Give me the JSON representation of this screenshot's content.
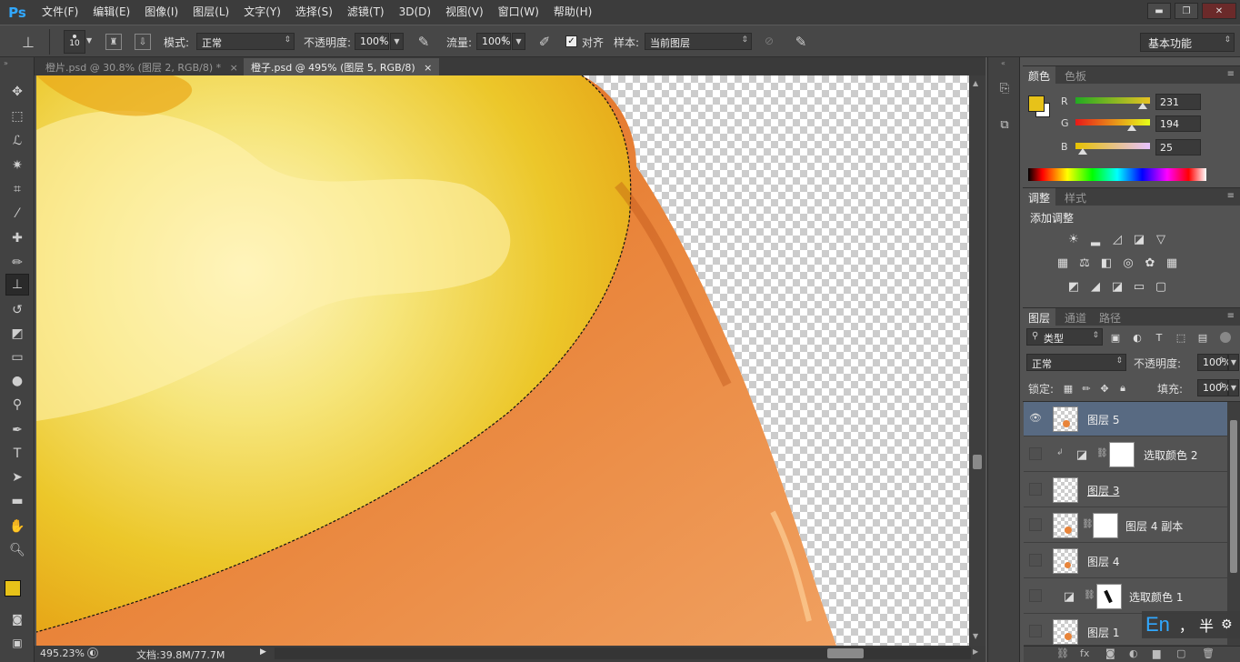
{
  "app": {
    "logo": "Ps"
  },
  "menu": [
    "文件(F)",
    "编辑(E)",
    "图像(I)",
    "图层(L)",
    "文字(Y)",
    "选择(S)",
    "滤镜(T)",
    "3D(D)",
    "视图(V)",
    "窗口(W)",
    "帮助(H)"
  ],
  "window_controls": {
    "minimize": "▬",
    "restore": "❐",
    "close": "✕"
  },
  "options": {
    "brush_size": "10",
    "mode_label": "模式:",
    "mode_value": "正常",
    "opacity_label": "不透明度:",
    "opacity_value": "100%",
    "flow_label": "流量:",
    "flow_value": "100%",
    "align_label": "对齐",
    "align_checked": true,
    "sample_label": "样本:",
    "sample_value": "当前图层"
  },
  "workspace": "基本功能",
  "tabs": [
    {
      "title": "橙片.psd @ 30.8% (图层 2, RGB/8) *",
      "close": "×",
      "active": false
    },
    {
      "title": "橙子.psd @ 495% (图层 5, RGB/8)",
      "close": "×",
      "active": true
    }
  ],
  "status": {
    "zoom": "495.23%",
    "doc": "文档:39.8M/77.7M"
  },
  "color_panel": {
    "tabs": [
      "颜色",
      "色板"
    ],
    "r_label": "R",
    "r_value": "231",
    "g_label": "G",
    "g_value": "194",
    "b_label": "B",
    "b_value": "25",
    "r_level": 0.906,
    "g_level": 0.761,
    "b_level": 0.098,
    "foreground_color": "#e7c219",
    "background_color": "#ffffff"
  },
  "adjust_panel": {
    "tabs": [
      "调整",
      "样式"
    ],
    "title": "添加调整"
  },
  "layers_panel": {
    "tabs": [
      "图层",
      "通道",
      "路径"
    ],
    "filter_value": "类型",
    "blend_mode": "正常",
    "opacity_label": "不透明度:",
    "opacity_value": "100%",
    "lock_label": "锁定:",
    "fill_label": "填充:",
    "fill_value": "100%",
    "layers": [
      {
        "name": "图层 5",
        "selected": true,
        "visible": true
      },
      {
        "name": "选取颜色 2",
        "selected": false,
        "visible": false
      },
      {
        "name": "图层 3",
        "selected": false,
        "visible": false
      },
      {
        "name": "图层 4 副本",
        "selected": false,
        "visible": false
      },
      {
        "name": "图层 4",
        "selected": false,
        "visible": false
      },
      {
        "name": "选取颜色 1",
        "selected": false,
        "visible": false
      },
      {
        "name": "图层 1",
        "selected": false,
        "visible": false
      }
    ]
  },
  "ime": {
    "lang": "En",
    "punct": "，",
    "width": "半"
  },
  "colors": {
    "accent": "#31a8ff",
    "selected_layer": "#586a82",
    "orange": "#e8843a",
    "yellow": "#e9c21c"
  }
}
